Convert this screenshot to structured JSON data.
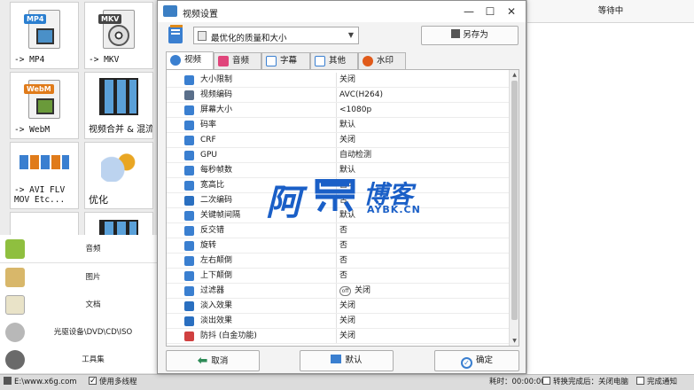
{
  "tiles": [
    {
      "label": "-> MP4",
      "badge": "MP4",
      "badge_color": "#2b7fd0"
    },
    {
      "label": "-> MKV",
      "badge": "MKV",
      "badge_color": "#444444"
    },
    {
      "label": "-> WebM",
      "badge": "WebM",
      "badge_color": "#e07b1a"
    },
    {
      "label": "视频合并 & 混流"
    },
    {
      "label": "-> AVI FLV\nMOV Etc..."
    },
    {
      "label": "优化"
    }
  ],
  "categories": [
    {
      "label": "音频",
      "icon": "music-icon",
      "color": "#8fbf3f"
    },
    {
      "label": "图片",
      "icon": "picture-icon",
      "color": "#d8b76a"
    },
    {
      "label": "文档",
      "icon": "document-icon",
      "color": "#e9e3c8"
    },
    {
      "label": "光驱设备\\DVD\\CD\\ISO",
      "icon": "disc-icon",
      "color": "#b8b8b8"
    },
    {
      "label": "工具集",
      "icon": "tools-icon",
      "color": "#6a6a6a"
    }
  ],
  "right_panel": {
    "header": "等待中"
  },
  "statusbar": {
    "path": "E:\\www.x6g.com",
    "multithread": "使用多线程",
    "elapsed": "耗时：00:00:00",
    "after_convert": "转换完成后：关闭电脑",
    "notify": "完成通知"
  },
  "dialog": {
    "title": "视频设置",
    "preset": "最优化的质量和大小",
    "save_as": "另存为",
    "tabs": [
      {
        "label": "视频",
        "icon": "video-icon",
        "color": "#3a7fd0"
      },
      {
        "label": "音频",
        "icon": "audio-icon",
        "color": "#e0457b"
      },
      {
        "label": "字幕",
        "icon": "subtitle-icon",
        "color": "#3a7fd0"
      },
      {
        "label": "其他",
        "icon": "other-icon",
        "color": "#3a7fd0"
      },
      {
        "label": "水印",
        "icon": "watermark-icon",
        "color": "#e05a1a"
      }
    ],
    "rows": [
      {
        "label": "大小限制",
        "value": "关闭",
        "icon": "size-limit-icon",
        "color": "#3a7fd0"
      },
      {
        "label": "视频编码",
        "value": "AVC(H264)",
        "icon": "codec-icon",
        "color": "#5a6f8a"
      },
      {
        "label": "屏幕大小",
        "value": "<1080p",
        "icon": "screen-size-icon",
        "color": "#3a7fd0"
      },
      {
        "label": "码率",
        "value": "默认",
        "icon": "bitrate-icon",
        "color": "#3a7fd0"
      },
      {
        "label": "CRF",
        "value": "关闭",
        "icon": "crf-icon",
        "color": "#3a7fd0"
      },
      {
        "label": "GPU",
        "value": "自动检测",
        "icon": "gpu-icon",
        "color": "#3a7fd0"
      },
      {
        "label": "每秒帧数",
        "value": "默认",
        "icon": "fps-icon",
        "color": "#3a7fd0"
      },
      {
        "label": "宽高比",
        "value": "自动",
        "icon": "aspect-ratio-icon",
        "color": "#3a7fd0"
      },
      {
        "label": "二次编码",
        "value": "否",
        "icon": "two-pass-icon",
        "color": "#2a6fc0"
      },
      {
        "label": "关键帧间隔",
        "value": "默认",
        "icon": "keyframe-icon",
        "color": "#3a7fd0"
      },
      {
        "label": "反交错",
        "value": "否",
        "icon": "deinterlace-icon",
        "color": "#3a7fd0"
      },
      {
        "label": "旋转",
        "value": "否",
        "icon": "rotate-icon",
        "color": "#3a7fd0"
      },
      {
        "label": "左右颠倒",
        "value": "否",
        "icon": "flip-horizontal-icon",
        "color": "#3a7fd0"
      },
      {
        "label": "上下颠倒",
        "value": "否",
        "icon": "flip-vertical-icon",
        "color": "#3a7fd0"
      },
      {
        "label": "过滤器",
        "value": "关闭",
        "icon": "filter-icon",
        "color": "#3a7fd0",
        "value_icon": "off"
      },
      {
        "label": "淡入效果",
        "value": "关闭",
        "icon": "fade-in-icon",
        "color": "#2a6fc0"
      },
      {
        "label": "淡出效果",
        "value": "关闭",
        "icon": "fade-out-icon",
        "color": "#2a6fc0"
      },
      {
        "label": "防抖 (白金功能)",
        "value": "关闭",
        "icon": "stabilize-icon",
        "color": "#d04040"
      }
    ],
    "cancel": "取消",
    "default": "默认",
    "ok": "确定"
  },
  "watermark": {
    "big": "阿",
    "mid": "博客",
    "sub": "AYBK.CN"
  }
}
